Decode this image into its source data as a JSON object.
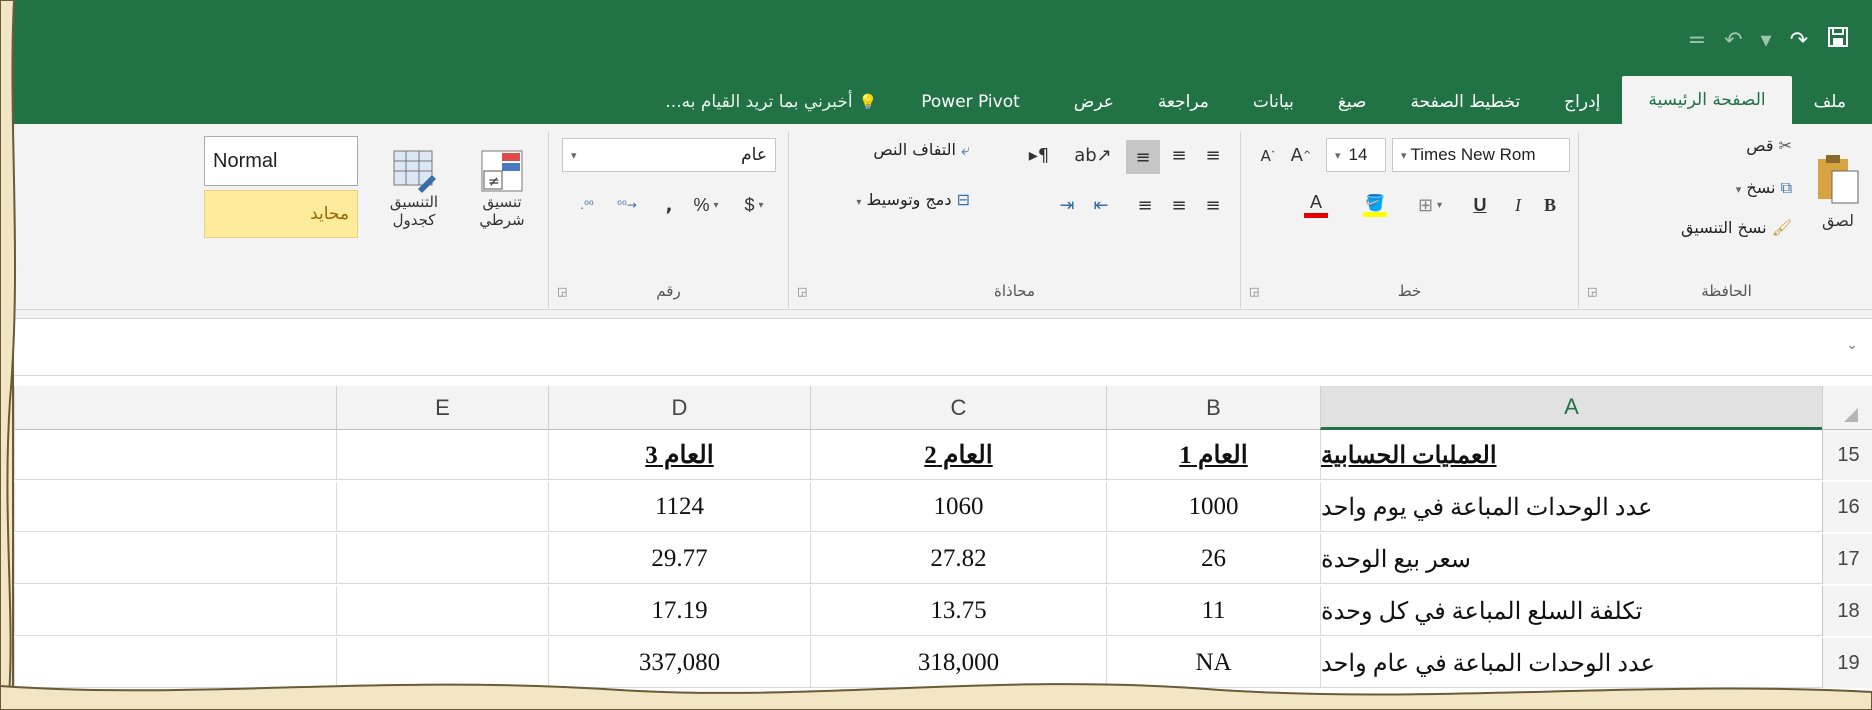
{
  "quick_access": {
    "undo": "↶",
    "redo": "↷",
    "save": "💾",
    "customize": "="
  },
  "tabs": [
    {
      "label": "ملف"
    },
    {
      "label": "الصفحة الرئيسية",
      "active": true
    },
    {
      "label": "إدراج"
    },
    {
      "label": "تخطيط الصفحة"
    },
    {
      "label": "صيغ"
    },
    {
      "label": "بيانات"
    },
    {
      "label": "مراجعة"
    },
    {
      "label": "عرض"
    },
    {
      "label": "Power Pivot"
    },
    {
      "label": "أخبرني بما تريد القيام به..."
    }
  ],
  "ribbon": {
    "clipboard": {
      "label": "الحافظة",
      "paste": "لصق",
      "cut": "قص",
      "copy": "نسخ",
      "format_painter": "نسخ التنسيق"
    },
    "font": {
      "label": "خط",
      "font_name": "Times New Rom",
      "font_size": "14",
      "bold": "B",
      "italic": "I",
      "underline": "U",
      "font_color": "#e00000",
      "highlight_color": "#ffff00"
    },
    "alignment": {
      "label": "محاذاة",
      "wrap_text": "التفاف النص",
      "merge_center": "دمج وتوسيط"
    },
    "number": {
      "label": "رقم",
      "format": "عام",
      "currency": "$",
      "percent": "%",
      "comma": ","
    },
    "styles": {
      "conditional": "تنسيق شرطي",
      "format_table": "التنسيق كجدول",
      "normal": "Normal",
      "neutral": "محايد"
    }
  },
  "grid": {
    "columns": [
      "A",
      "B",
      "C",
      "D",
      "E"
    ],
    "active_column": "A",
    "rows": [
      {
        "num": "15",
        "a": "العمليات الحسابية",
        "b": "العام 1",
        "c": "العام 2",
        "d": "العام 3",
        "e": "",
        "header": true
      },
      {
        "num": "16",
        "a": "عدد الوحدات المباعة في يوم واحد",
        "b": "1000",
        "c": "1060",
        "d": "1124",
        "e": ""
      },
      {
        "num": "17",
        "a": "سعر بيع الوحدة",
        "b": "26",
        "c": "27.82",
        "d": "29.77",
        "e": ""
      },
      {
        "num": "18",
        "a": "تكلفة السلع المباعة في كل وحدة",
        "b": "11",
        "c": "13.75",
        "d": "17.19",
        "e": ""
      },
      {
        "num": "19",
        "a": "عدد الوحدات المباعة في عام واحد",
        "b": "NA",
        "c": "318,000",
        "d": "337,080",
        "e": ""
      }
    ]
  },
  "colors": {
    "accent": "#217346"
  }
}
